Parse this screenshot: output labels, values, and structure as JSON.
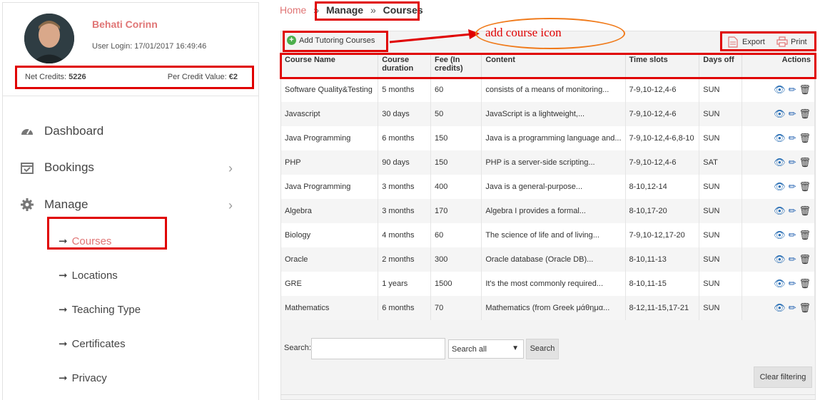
{
  "profile": {
    "name": "Behati Corinn",
    "login": "User Login: 17/01/2017 16:49:46",
    "net_credits_label": "Net Credits:",
    "net_credits_value": "5226",
    "per_credit_label": "Per Credit Value:",
    "per_credit_value": "€2"
  },
  "nav": {
    "dashboard": "Dashboard",
    "bookings": "Bookings",
    "manage": "Manage",
    "sub_items": [
      "Courses",
      "Locations",
      "Teaching Type",
      "Certificates",
      "Privacy"
    ],
    "active_color": "#e07575"
  },
  "breadcrumb": {
    "home": "Home",
    "manage": "Manage",
    "current": "Courses",
    "separator": "»"
  },
  "toolbar": {
    "add_label": "Add Tutoring Courses",
    "export_label": "Export",
    "print_label": "Print"
  },
  "annotation": {
    "text": "add course icon"
  },
  "table": {
    "columns": [
      "Course Name",
      "Course duration",
      "Fee (In credits)",
      "Content",
      "Time slots",
      "Days off",
      "Actions"
    ],
    "rows": [
      [
        "Software Quality&Testing",
        "5 months",
        "60",
        " consists of a means of monitoring...",
        "7-9,10-12,4-6",
        "SUN"
      ],
      [
        "Javascript",
        "30 days",
        "50",
        "JavaScript is a lightweight,...",
        "7-9,10-12,4-6",
        "SUN"
      ],
      [
        "Java Programming",
        "6 months",
        "150",
        "Java is a programming language and...",
        "7-9,10-12,4-6,8-10",
        "SUN"
      ],
      [
        "PHP",
        "90 days",
        "150",
        "PHP is a server-side scripting...",
        "7-9,10-12,4-6",
        "SAT"
      ],
      [
        "Java Programming",
        "3 months",
        "400",
        "Java is a general-purpose...",
        "8-10,12-14",
        "SUN"
      ],
      [
        "Algebra",
        "3 months",
        "170",
        "Algebra I provides a formal...",
        "8-10,17-20",
        "SUN"
      ],
      [
        "Biology",
        "4 months",
        "60",
        "The science of life and of living...",
        "7-9,10-12,17-20",
        "SUN"
      ],
      [
        "Oracle",
        "2 months",
        "300",
        "Oracle database (Oracle DB)...",
        "8-10,11-13",
        "SUN"
      ],
      [
        "GRE",
        "1 years",
        "1500",
        "It's the most commonly required...",
        "8-10,11-15",
        "SUN"
      ],
      [
        "Mathematics",
        "6 months",
        "70",
        "Mathematics (from Greek μάθημα...",
        "8-12,11-15,17-21",
        "SUN"
      ]
    ]
  },
  "search": {
    "label": "Search:",
    "value": "",
    "select_value": "Search all",
    "button_label": "Search",
    "clear_label": "Clear filtering"
  },
  "colors": {
    "highlight": "#e00000",
    "accent": "#e07575",
    "annotation_ellipse": "#f07a1a"
  }
}
